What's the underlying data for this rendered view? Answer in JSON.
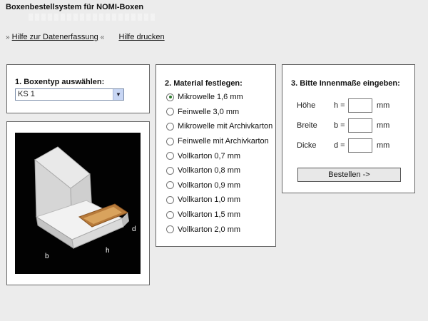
{
  "header": {
    "title": "Boxenbestellsystem für NOMI-Boxen",
    "links": [
      {
        "prefix": "»",
        "label": "Hilfe zur Datenerfassung",
        "suffix": "«"
      },
      {
        "label": "Hilfe drucken"
      }
    ]
  },
  "box_type": {
    "heading": "1. Boxentyp auswählen:",
    "selected": "KS 1"
  },
  "preview": {
    "dimension_labels": {
      "b": "b",
      "h": "h",
      "d": "d"
    }
  },
  "material": {
    "heading": "2. Material festlegen:",
    "options": [
      {
        "label": "Mikrowelle 1,6 mm",
        "checked": true
      },
      {
        "label": "Feinwelle 3,0 mm",
        "checked": false
      },
      {
        "label": "Mikrowelle mit Archivkarton",
        "checked": false
      },
      {
        "label": "Feinwelle mit Archivkarton",
        "checked": false
      },
      {
        "label": "Vollkarton 0,7 mm",
        "checked": false
      },
      {
        "label": "Vollkarton 0,8 mm",
        "checked": false
      },
      {
        "label": "Vollkarton 0,9 mm",
        "checked": false
      },
      {
        "label": "Vollkarton 1,0 mm",
        "checked": false
      },
      {
        "label": "Vollkarton 1,5 mm",
        "checked": false
      },
      {
        "label": "Vollkarton 2,0 mm",
        "checked": false
      }
    ]
  },
  "dimensions": {
    "heading": "3. Bitte Innenmaße eingeben:",
    "fields": [
      {
        "name": "Höhe",
        "var": "h =",
        "value": "",
        "unit": "mm"
      },
      {
        "name": "Breite",
        "var": "b =",
        "value": "",
        "unit": "mm"
      },
      {
        "name": "Dicke",
        "var": "d =",
        "value": "",
        "unit": "mm"
      }
    ],
    "order_label": "Bestellen ->"
  }
}
